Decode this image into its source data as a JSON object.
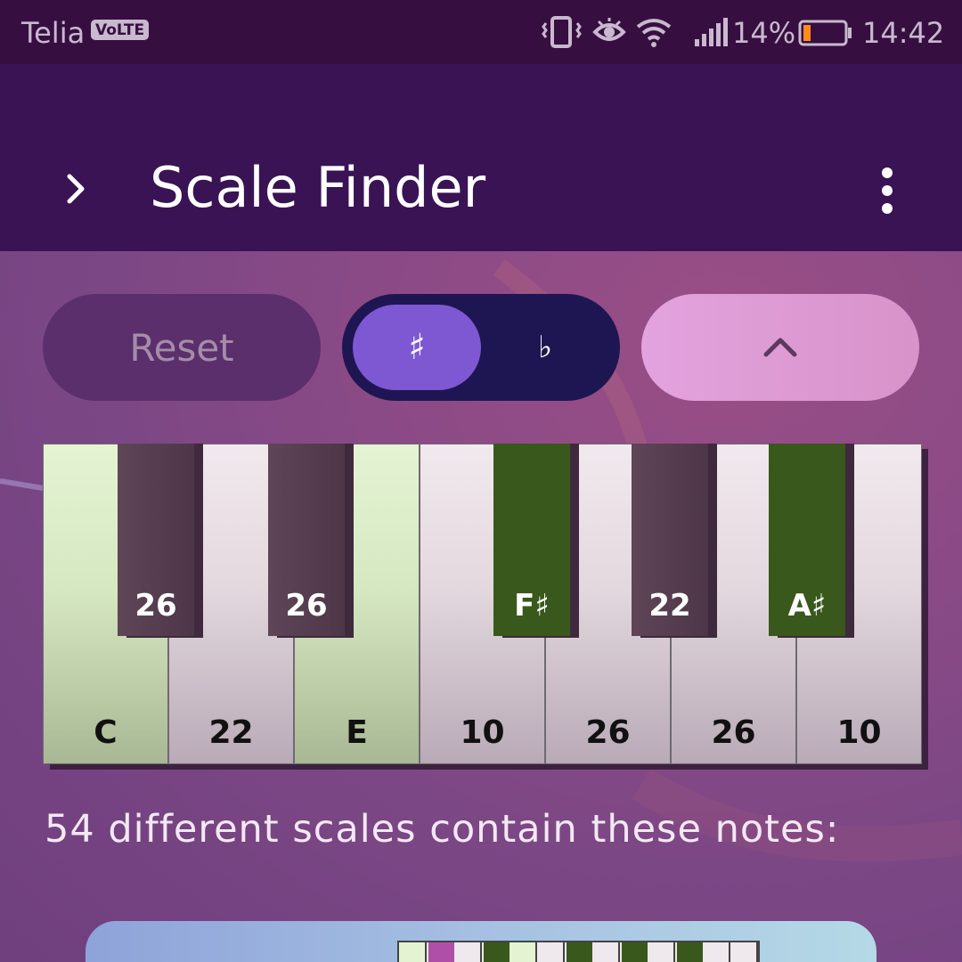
{
  "status_bar": {
    "carrier": "Telia",
    "volte": "VoLTE",
    "battery_percent": "14%",
    "time": "14:42",
    "icons": [
      "vibrate-icon",
      "eye-icon",
      "wifi-icon",
      "signal-icon",
      "battery-icon"
    ]
  },
  "app_bar": {
    "title": "Scale Finder",
    "nav_icon": "chevron-right-icon",
    "menu_icon": "overflow-menu-icon"
  },
  "controls": {
    "reset_label": "Reset",
    "sharp_label": "♯",
    "flat_label": "♭",
    "selected_accidental": "sharp",
    "collapse_icon": "chevron-up-icon"
  },
  "piano": {
    "white_keys": [
      {
        "label": "C",
        "highlight": true
      },
      {
        "label": "22",
        "highlight": false
      },
      {
        "label": "E",
        "highlight": true
      },
      {
        "label": "10",
        "highlight": false
      },
      {
        "label": "26",
        "highlight": false
      },
      {
        "label": "26",
        "highlight": false
      },
      {
        "label": "10",
        "highlight": false
      }
    ],
    "black_keys": [
      {
        "label": "26",
        "highlight": false
      },
      {
        "label": "26",
        "highlight": false
      },
      {
        "label": "F♯",
        "highlight": true
      },
      {
        "label": "22",
        "highlight": false
      },
      {
        "label": "A♯",
        "highlight": true
      }
    ]
  },
  "results": {
    "summary": "54 different scales contain these notes:"
  },
  "colors": {
    "status_bar": "#360f40",
    "app_bar": "#391354",
    "highlight_black": "#39581c",
    "highlight_white": "#d6e8c2",
    "toggle_selected": "#7e57d2"
  }
}
